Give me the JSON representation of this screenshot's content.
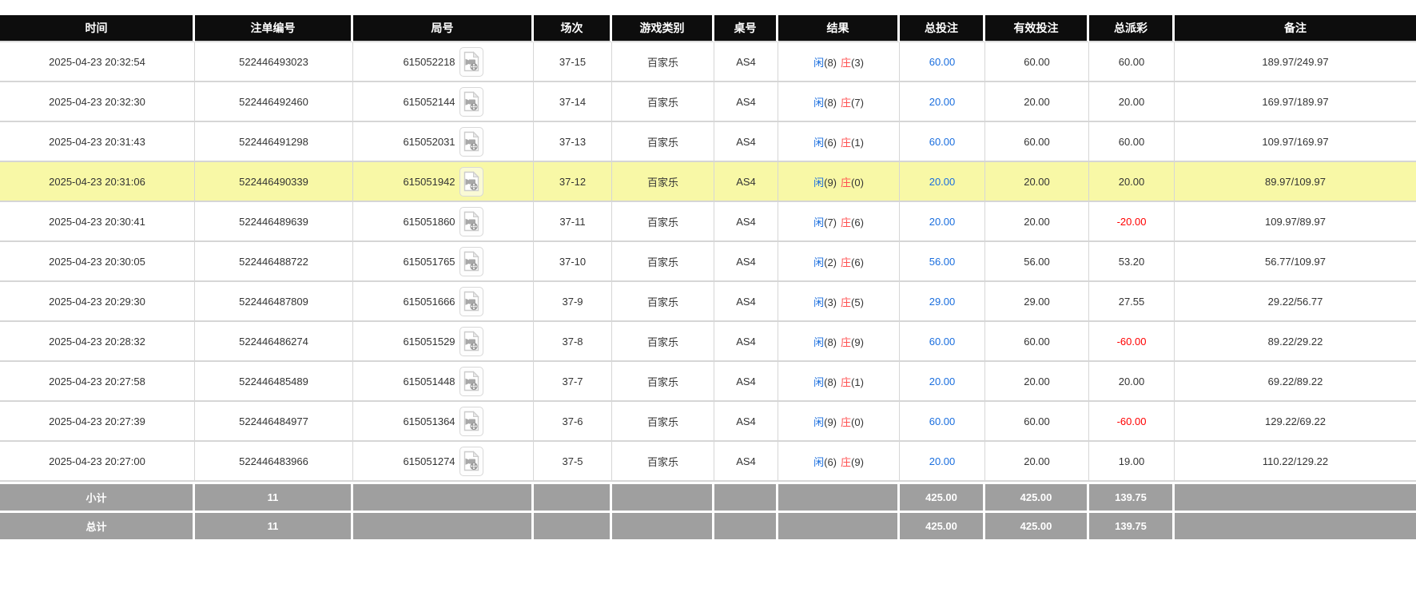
{
  "colors": {
    "header_bg": "#0d0d0d",
    "footer_bg": "#9f9f9f",
    "highlight_row": "#f8f8a6",
    "player_blue": "#1a6ede",
    "banker_red": "#ff5050",
    "bet_amount_blue": "#1a6ede",
    "negative_payout_red": "#ff0000",
    "grid_line": "#d6d6d6"
  },
  "table": {
    "columns": [
      "时间",
      "注单编号",
      "局号",
      "场次",
      "游戏类别",
      "桌号",
      "结果",
      "总投注",
      "有效投注",
      "总派彩",
      "备注"
    ],
    "round_icon": "video-file-icon",
    "rows": [
      {
        "time": "2025-04-23 20:32:54",
        "bet_no": "522446493023",
        "round_no": "615052218",
        "session": "37-15",
        "game_type": "百家乐",
        "table_no": "AS4",
        "result": {
          "player": "闲",
          "player_score": "(8)",
          "banker": "庄",
          "banker_score": "(3)"
        },
        "total_bet": "60.00",
        "valid_bet": "60.00",
        "payout": "60.00",
        "remark": "189.97/249.97",
        "highlighted": false
      },
      {
        "time": "2025-04-23 20:32:30",
        "bet_no": "522446492460",
        "round_no": "615052144",
        "session": "37-14",
        "game_type": "百家乐",
        "table_no": "AS4",
        "result": {
          "player": "闲",
          "player_score": "(8)",
          "banker": "庄",
          "banker_score": "(7)"
        },
        "total_bet": "20.00",
        "valid_bet": "20.00",
        "payout": "20.00",
        "remark": "169.97/189.97",
        "highlighted": false
      },
      {
        "time": "2025-04-23 20:31:43",
        "bet_no": "522446491298",
        "round_no": "615052031",
        "session": "37-13",
        "game_type": "百家乐",
        "table_no": "AS4",
        "result": {
          "player": "闲",
          "player_score": "(6)",
          "banker": "庄",
          "banker_score": "(1)"
        },
        "total_bet": "60.00",
        "valid_bet": "60.00",
        "payout": "60.00",
        "remark": "109.97/169.97",
        "highlighted": false
      },
      {
        "time": "2025-04-23 20:31:06",
        "bet_no": "522446490339",
        "round_no": "615051942",
        "session": "37-12",
        "game_type": "百家乐",
        "table_no": "AS4",
        "result": {
          "player": "闲",
          "player_score": "(9)",
          "banker": "庄",
          "banker_score": "(0)"
        },
        "total_bet": "20.00",
        "valid_bet": "20.00",
        "payout": "20.00",
        "remark": "89.97/109.97",
        "highlighted": true
      },
      {
        "time": "2025-04-23 20:30:41",
        "bet_no": "522446489639",
        "round_no": "615051860",
        "session": "37-11",
        "game_type": "百家乐",
        "table_no": "AS4",
        "result": {
          "player": "闲",
          "player_score": "(7)",
          "banker": "庄",
          "banker_score": "(6)"
        },
        "total_bet": "20.00",
        "valid_bet": "20.00",
        "payout": "-20.00",
        "remark": "109.97/89.97",
        "highlighted": false
      },
      {
        "time": "2025-04-23 20:30:05",
        "bet_no": "522446488722",
        "round_no": "615051765",
        "session": "37-10",
        "game_type": "百家乐",
        "table_no": "AS4",
        "result": {
          "player": "闲",
          "player_score": "(2)",
          "banker": "庄",
          "banker_score": "(6)"
        },
        "total_bet": "56.00",
        "valid_bet": "56.00",
        "payout": "53.20",
        "remark": "56.77/109.97",
        "highlighted": false
      },
      {
        "time": "2025-04-23 20:29:30",
        "bet_no": "522446487809",
        "round_no": "615051666",
        "session": "37-9",
        "game_type": "百家乐",
        "table_no": "AS4",
        "result": {
          "player": "闲",
          "player_score": "(3)",
          "banker": "庄",
          "banker_score": "(5)"
        },
        "total_bet": "29.00",
        "valid_bet": "29.00",
        "payout": "27.55",
        "remark": "29.22/56.77",
        "highlighted": false
      },
      {
        "time": "2025-04-23 20:28:32",
        "bet_no": "522446486274",
        "round_no": "615051529",
        "session": "37-8",
        "game_type": "百家乐",
        "table_no": "AS4",
        "result": {
          "player": "闲",
          "player_score": "(8)",
          "banker": "庄",
          "banker_score": "(9)"
        },
        "total_bet": "60.00",
        "valid_bet": "60.00",
        "payout": "-60.00",
        "remark": "89.22/29.22",
        "highlighted": false
      },
      {
        "time": "2025-04-23 20:27:58",
        "bet_no": "522446485489",
        "round_no": "615051448",
        "session": "37-7",
        "game_type": "百家乐",
        "table_no": "AS4",
        "result": {
          "player": "闲",
          "player_score": "(8)",
          "banker": "庄",
          "banker_score": "(1)"
        },
        "total_bet": "20.00",
        "valid_bet": "20.00",
        "payout": "20.00",
        "remark": "69.22/89.22",
        "highlighted": false
      },
      {
        "time": "2025-04-23 20:27:39",
        "bet_no": "522446484977",
        "round_no": "615051364",
        "session": "37-6",
        "game_type": "百家乐",
        "table_no": "AS4",
        "result": {
          "player": "闲",
          "player_score": "(9)",
          "banker": "庄",
          "banker_score": "(0)"
        },
        "total_bet": "60.00",
        "valid_bet": "60.00",
        "payout": "-60.00",
        "remark": "129.22/69.22",
        "highlighted": false
      },
      {
        "time": "2025-04-23 20:27:00",
        "bet_no": "522446483966",
        "round_no": "615051274",
        "session": "37-5",
        "game_type": "百家乐",
        "table_no": "AS4",
        "result": {
          "player": "闲",
          "player_score": "(6)",
          "banker": "庄",
          "banker_score": "(9)"
        },
        "total_bet": "20.00",
        "valid_bet": "20.00",
        "payout": "19.00",
        "remark": "110.22/129.22",
        "highlighted": false
      }
    ],
    "subtotal": {
      "label": "小计",
      "count": "11",
      "total_bet": "425.00",
      "valid_bet": "425.00",
      "payout": "139.75"
    },
    "total": {
      "label": "总计",
      "count": "11",
      "total_bet": "425.00",
      "valid_bet": "425.00",
      "payout": "139.75"
    }
  }
}
